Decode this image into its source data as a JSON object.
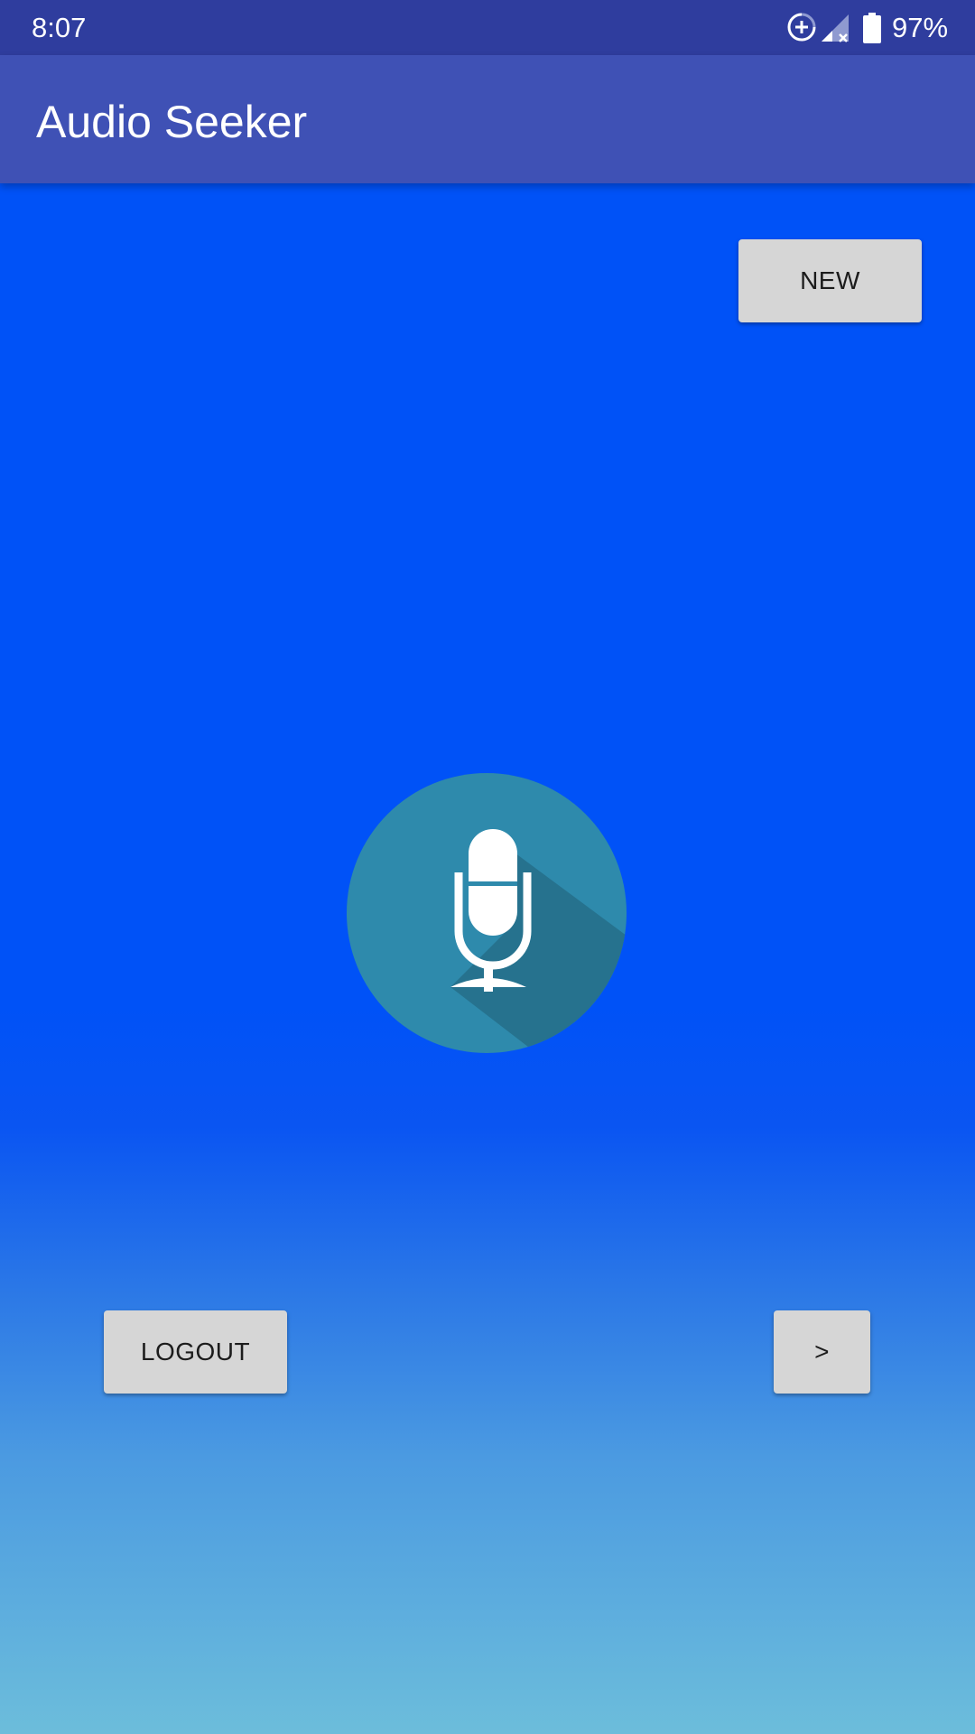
{
  "status_bar": {
    "time": "8:07",
    "battery_percent": "97%",
    "icons": [
      "sync-icon",
      "signal-no-sim-icon",
      "battery-icon"
    ]
  },
  "app_bar": {
    "title": "Audio Seeker"
  },
  "main": {
    "new_button_label": "NEW",
    "record_button_icon": "microphone-icon",
    "logout_button_label": "LOGOUT",
    "next_button_label": ">"
  },
  "colors": {
    "status_bar": "#2f3d9e",
    "app_bar": "#3f51b5",
    "background_top": "#0052f7",
    "background_bottom": "#6cbddb",
    "mic_circle": "#2e8aac",
    "button_bg": "#d6d6d6"
  }
}
